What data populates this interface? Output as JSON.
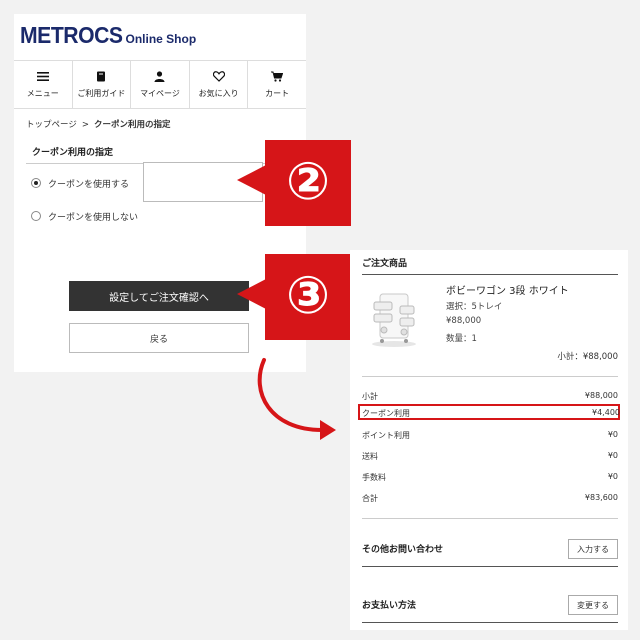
{
  "logo": {
    "main": "METROCS",
    "sub": "Online Shop"
  },
  "nav": [
    {
      "label": "メニュー",
      "icon": "menu-icon"
    },
    {
      "label": "ご利用ガイド",
      "icon": "guide-book-icon"
    },
    {
      "label": "マイページ",
      "icon": "user-icon"
    },
    {
      "label": "お気に入り",
      "icon": "heart-icon"
    },
    {
      "label": "カート",
      "icon": "cart-icon"
    }
  ],
  "breadcrumb": {
    "home": "トップページ",
    "sep": ">",
    "current": "クーポン利用の指定"
  },
  "coupon_form": {
    "title": "クーポン利用の指定",
    "use_label": "クーポンを使用する",
    "no_use_label": "クーポンを使用しない",
    "input_value": "",
    "confirm_label": "設定してご注文確認へ",
    "back_label": "戻る"
  },
  "callouts": {
    "step2": "②",
    "step3": "③",
    "color": "#d61518"
  },
  "order": {
    "title": "ご注文商品",
    "product": {
      "name": "ボビーワゴン 3段 ホワイト",
      "option": "選択：5トレイ",
      "price": "¥88,000",
      "qty": "数量：1",
      "subtotal": "小計：¥88,000"
    },
    "summary": [
      {
        "label": "小計",
        "value": "¥88,000"
      },
      {
        "label": "クーポン利用",
        "value": "¥4,400"
      },
      {
        "label": "ポイント利用",
        "value": "¥0"
      },
      {
        "label": "送料",
        "value": "¥0"
      },
      {
        "label": "手数料",
        "value": "¥0"
      },
      {
        "label": "合計",
        "value": "¥83,600"
      }
    ],
    "inquiry": {
      "label": "その他お問い合わせ",
      "button": "入力する"
    },
    "payment": {
      "label": "お支払い方法",
      "button": "変更する"
    }
  }
}
